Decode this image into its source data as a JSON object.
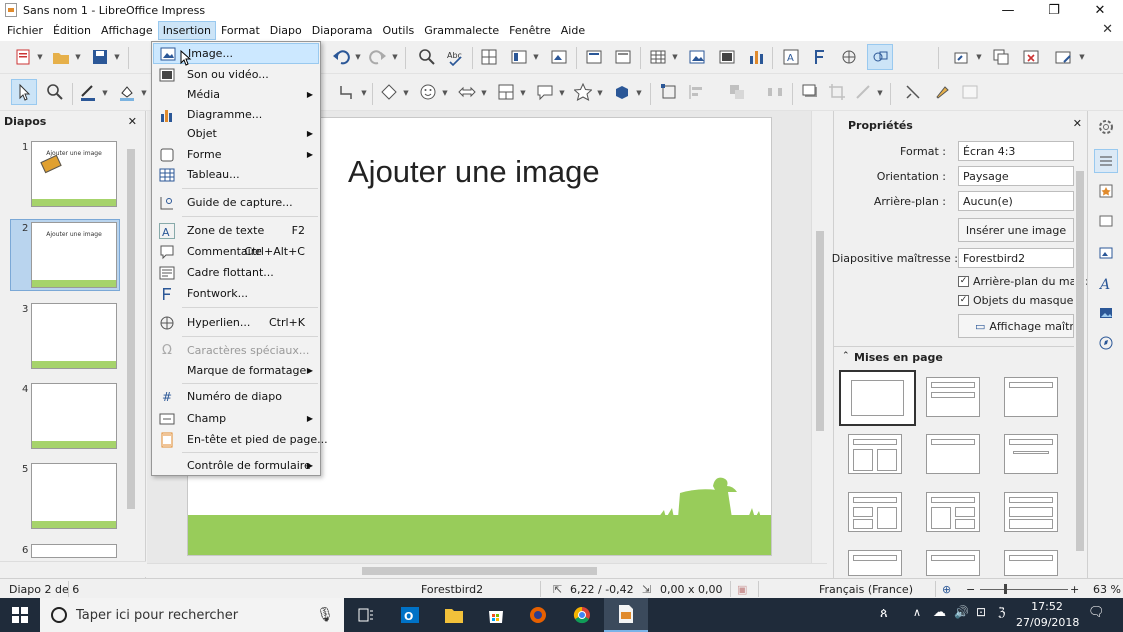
{
  "window": {
    "title": "Sans nom 1 - LibreOffice Impress",
    "minimize": "—",
    "restore": "❐",
    "close": "✕",
    "doc_close": "✕"
  },
  "menubar": [
    {
      "label": "Fichier"
    },
    {
      "label": "Édition"
    },
    {
      "label": "Affichage"
    },
    {
      "label": "Insertion",
      "active": true
    },
    {
      "label": "Format"
    },
    {
      "label": "Diapo"
    },
    {
      "label": "Diaporama"
    },
    {
      "label": "Outils"
    },
    {
      "label": "Grammalecte"
    },
    {
      "label": "Fenêtre"
    },
    {
      "label": "Aide"
    }
  ],
  "insert_menu": {
    "items": [
      {
        "label": "Image...",
        "icon": "image-icon",
        "hover": true
      },
      {
        "label": "Son ou vidéo...",
        "icon": "media-icon"
      },
      {
        "label": "Média",
        "submenu": true
      },
      {
        "label": "Diagramme...",
        "icon": "chart-icon"
      },
      {
        "label": "Objet",
        "submenu": true
      },
      {
        "label": "Forme",
        "icon": "shape-icon",
        "submenu": true
      },
      {
        "label": "Tableau...",
        "icon": "table-icon"
      },
      {
        "label": "Guide de capture...",
        "icon": "snap-guide-icon"
      },
      {
        "label": "Zone de texte",
        "icon": "text-box-icon",
        "shortcut": "F2"
      },
      {
        "label": "Commentaire",
        "icon": "comment-icon",
        "shortcut": "Ctrl+Alt+C"
      },
      {
        "label": "Cadre flottant...",
        "icon": "floating-frame-icon"
      },
      {
        "label": "Fontwork...",
        "icon": "fontwork-icon"
      },
      {
        "label": "Hyperlien...",
        "icon": "hyperlink-icon",
        "shortcut": "Ctrl+K"
      },
      {
        "label": "Caractères spéciaux...",
        "icon": "special-char-icon",
        "disabled": true
      },
      {
        "label": "Marque de formatage",
        "submenu": true
      },
      {
        "label": "Numéro de diapo",
        "icon": "slide-number-icon"
      },
      {
        "label": "Champ",
        "icon": "field-icon",
        "submenu": true
      },
      {
        "label": "En-tête et pied de page...",
        "icon": "header-footer-icon"
      },
      {
        "label": "Contrôle de formulaire",
        "submenu": true
      }
    ]
  },
  "slides_pane": {
    "title": "Diapos",
    "close": "✕",
    "slides": [
      {
        "num": "1",
        "title": "Ajouter une image"
      },
      {
        "num": "2",
        "title": "Ajouter une image",
        "selected": true
      },
      {
        "num": "3",
        "title": ""
      },
      {
        "num": "4",
        "title": ""
      },
      {
        "num": "5",
        "title": ""
      },
      {
        "num": "6",
        "title": ""
      }
    ]
  },
  "slide": {
    "title": "Ajouter une image"
  },
  "properties": {
    "title": "Propriétés",
    "close": "✕",
    "format_label": "Format :",
    "format_value": "Écran 4:3",
    "orientation_label": "Orientation :",
    "orientation_value": "Paysage",
    "background_label": "Arrière-plan :",
    "background_value": "Aucun(e)",
    "insert_image_button": "Insérer une image",
    "master_label": "Diapositive maîtresse :",
    "master_value": "Forestbird2",
    "master_background_check": "Arrière-plan du masque",
    "master_objects_check": "Objets du masque",
    "master_view_button": "Affichage maître",
    "layouts_title": "Mises en page"
  },
  "statusbar": {
    "slide_info": "Diapo 2 de 6",
    "master": "Forestbird2",
    "position": "6,22 / -0,42",
    "size": "0,00 x 0,00",
    "language": "Français (France)",
    "zoom": "63 %"
  },
  "taskbar": {
    "search_placeholder": "Taper ici pour rechercher",
    "time": "17:52",
    "date": "27/09/2018"
  },
  "colors": {
    "accent": "#cce8ff",
    "grass": "#98cc5a",
    "taskbar": "#1f2b3a"
  }
}
